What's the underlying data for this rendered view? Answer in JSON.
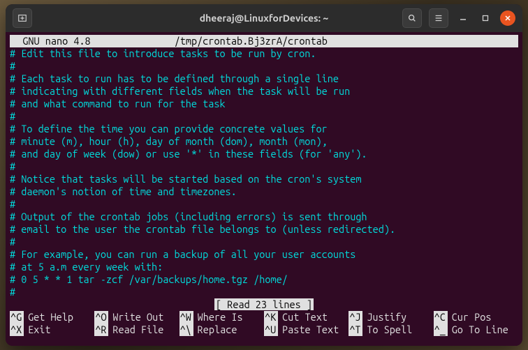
{
  "window": {
    "title": "dheeraj@LinuxforDevices: ~"
  },
  "nano": {
    "app_name": "  GNU nano 4.8",
    "file_path": "/tmp/crontab.Bj3zrA/crontab",
    "status": "[ Read 23 lines ]"
  },
  "content": [
    "# Edit this file to introduce tasks to be run by cron.",
    "#",
    "# Each task to run has to be defined through a single line",
    "# indicating with different fields when the task will be run",
    "# and what command to run for the task",
    "#",
    "# To define the time you can provide concrete values for",
    "# minute (m), hour (h), day of month (dom), month (mon),",
    "# and day of week (dow) or use '*' in these fields (for 'any').",
    "#",
    "# Notice that tasks will be started based on the cron's system",
    "# daemon's notion of time and timezones.",
    "#",
    "# Output of the crontab jobs (including errors) is sent through",
    "# email to the user the crontab file belongs to (unless redirected).",
    "#",
    "# For example, you can run a backup of all your user accounts",
    "# at 5 a.m every week with:",
    "# 0 5 * * 1 tar -zcf /var/backups/home.tgz /home/",
    "#"
  ],
  "help": {
    "row1": [
      {
        "key": "^G",
        "label": "Get Help"
      },
      {
        "key": "^O",
        "label": "Write Out"
      },
      {
        "key": "^W",
        "label": "Where Is"
      },
      {
        "key": "^K",
        "label": "Cut Text"
      },
      {
        "key": "^J",
        "label": "Justify"
      },
      {
        "key": "^C",
        "label": "Cur Pos"
      }
    ],
    "row2": [
      {
        "key": "^X",
        "label": "Exit"
      },
      {
        "key": "^R",
        "label": "Read File"
      },
      {
        "key": "^\\",
        "label": "Replace"
      },
      {
        "key": "^U",
        "label": "Paste Text"
      },
      {
        "key": "^T",
        "label": "To Spell"
      },
      {
        "key": "^_",
        "label": "Go To Line"
      }
    ]
  }
}
